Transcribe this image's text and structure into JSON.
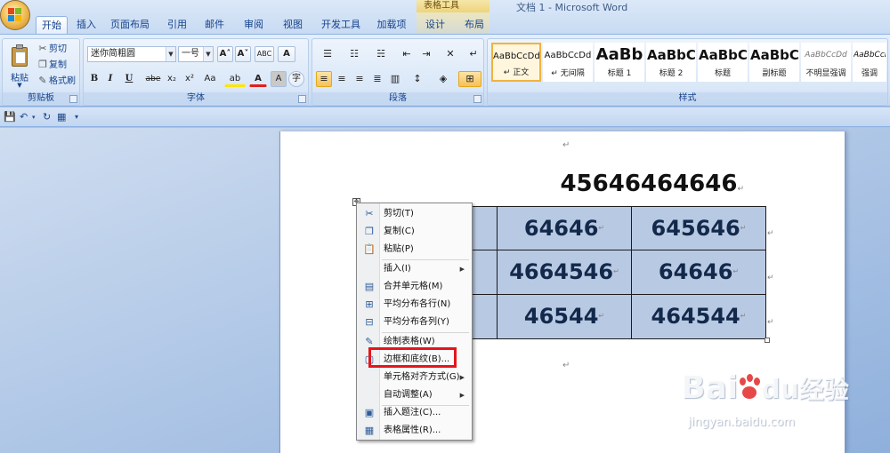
{
  "window": {
    "title": "文档 1 - Microsoft Word",
    "context_tab_group": "表格工具"
  },
  "tabs": [
    {
      "label": "开始",
      "active": true
    },
    {
      "label": "插入"
    },
    {
      "label": "页面布局"
    },
    {
      "label": "引用"
    },
    {
      "label": "邮件"
    },
    {
      "label": "审阅"
    },
    {
      "label": "视图"
    },
    {
      "label": "开发工具"
    },
    {
      "label": "加载项"
    },
    {
      "label": "设计"
    },
    {
      "label": "布局"
    }
  ],
  "ribbon": {
    "clipboard": {
      "label": "剪贴板",
      "paste": "粘贴",
      "cut": "剪切",
      "copy": "复制",
      "format_painter": "格式刷"
    },
    "font": {
      "label": "字体",
      "font_name": "迷你简粗圆",
      "font_size": "一号",
      "grow": "A˄",
      "shrink": "A˅",
      "clear": "ABC",
      "border_a": "A",
      "bold": "B",
      "italic": "I",
      "underline": "U",
      "strike": "abe",
      "subscript": "x₂",
      "superscript": "x²",
      "change_case": "Aa",
      "highlight": "ab",
      "font_color": "A",
      "char_shade": "A",
      "enclose": "字"
    },
    "paragraph": {
      "label": "段落"
    },
    "styles": {
      "label": "样式",
      "items": [
        {
          "sample": "AaBbCcDd",
          "name": "↵ 正文",
          "active": true
        },
        {
          "sample": "AaBbCcDd",
          "name": "↵ 无间隔"
        },
        {
          "sample": "AaBb",
          "name": "标题 1"
        },
        {
          "sample": "AaBbC",
          "name": "标题 2"
        },
        {
          "sample": "AaBbC",
          "name": "标题"
        },
        {
          "sample": "AaBbC",
          "name": "副标题"
        },
        {
          "sample": "AaBbCcDd",
          "name": "不明显强调"
        },
        {
          "sample": "AaBbCcDd",
          "name": "强调"
        }
      ]
    }
  },
  "document": {
    "heading": "45646464646",
    "para_mark": "↵",
    "table": [
      [
        "",
        "64646",
        "645646"
      ],
      [
        "",
        "4664546",
        "64646"
      ],
      [
        "",
        "46544",
        "464544"
      ]
    ]
  },
  "context_menu": {
    "items": [
      {
        "label": "剪切(T)",
        "icon": "scissors-icon",
        "glyph": "✂"
      },
      {
        "label": "复制(C)",
        "icon": "copy-icon",
        "glyph": "❐"
      },
      {
        "label": "粘贴(P)",
        "icon": "paste-icon",
        "glyph": "📋"
      },
      {
        "separator": true
      },
      {
        "label": "插入(I)",
        "submenu": true
      },
      {
        "label": "合并单元格(M)",
        "icon": "merge-cells-icon",
        "glyph": "▤"
      },
      {
        "label": "平均分布各行(N)",
        "icon": "distribute-rows-icon",
        "glyph": "⊞"
      },
      {
        "label": "平均分布各列(Y)",
        "icon": "distribute-columns-icon",
        "glyph": "⊟"
      },
      {
        "separator": true
      },
      {
        "label": "绘制表格(W)",
        "icon": "draw-table-icon",
        "glyph": "✎"
      },
      {
        "label": "边框和底纹(B)...",
        "icon": "borders-shading-icon",
        "glyph": "▢"
      },
      {
        "label": "单元格对齐方式(G)",
        "submenu": true
      },
      {
        "label": "自动调整(A)",
        "submenu": true
      },
      {
        "separator": true
      },
      {
        "label": "插入题注(C)...",
        "icon": "caption-icon",
        "glyph": "▣"
      },
      {
        "label": "表格属性(R)...",
        "icon": "table-properties-icon",
        "glyph": "▦"
      }
    ]
  },
  "watermark": {
    "text_left": "Bai",
    "text_right": "经验",
    "url": "jingyan.baidu.com"
  },
  "colors": {
    "ribbon_blue": "#d5e4f7",
    "table_fill": "#b8c9e3",
    "highlight_red": "#e3161b",
    "accent_orange": "#f2b23f"
  }
}
